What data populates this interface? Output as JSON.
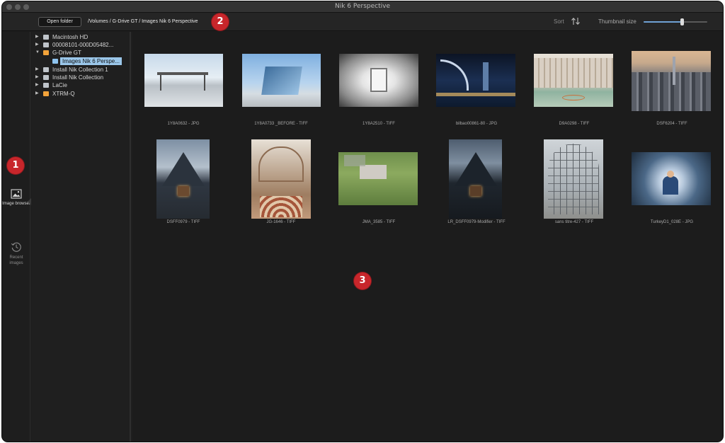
{
  "window": {
    "title": "Nik 6 Perspective"
  },
  "toolbar": {
    "open_folder_label": "Open folder",
    "path": "/Volumes / G-Drive GT / Images Nik 6 Perspective",
    "sort_label": "Sort",
    "sort_icon": "sort-arrows-icon",
    "thumbnail_size_label": "Thumbnail size",
    "thumbnail_size_value": 0.6
  },
  "sidebar": {
    "items": [
      {
        "label": "Image browser",
        "icon": "image-icon",
        "active": true
      },
      {
        "label": "Recent images",
        "icon": "clock-history-icon",
        "active": false
      }
    ]
  },
  "tree": {
    "items": [
      {
        "label": "Macintosh HD",
        "icon": "hard-drive-icon",
        "expanded": false,
        "color": "#bfc4ca"
      },
      {
        "label": "00008101-000D05482...",
        "icon": "device-icon",
        "expanded": false,
        "color": "#bfc4ca"
      },
      {
        "label": "G-Drive GT",
        "icon": "external-drive-icon",
        "expanded": true,
        "color": "#f2a33a"
      },
      {
        "label": "Images Nik 6 Perspe...",
        "icon": "folder-icon",
        "selected": true,
        "color": "#8ec3ee"
      },
      {
        "label": "Install Nik Collection 1",
        "icon": "disk-image-icon",
        "expanded": false,
        "color": "#bfc4ca"
      },
      {
        "label": "Install Nik Collection",
        "icon": "disk-image-icon",
        "expanded": false,
        "color": "#bfc4ca"
      },
      {
        "label": "LaCie",
        "icon": "hard-drive-icon",
        "expanded": false,
        "color": "#bfc4ca"
      },
      {
        "label": "XTRM-Q",
        "icon": "external-drive-icon",
        "expanded": false,
        "color": "#f2a33a"
      }
    ]
  },
  "thumbnails": [
    {
      "caption": "1Y8A0632 - JPG"
    },
    {
      "caption": "1Y8A0733 _BEFORE - TIFF"
    },
    {
      "caption": "1Y8A2510 - TIFF"
    },
    {
      "caption": "bilbao00861-80 - JPG"
    },
    {
      "caption": "D9A0298 - TIFF"
    },
    {
      "caption": "DSF6204 - TIFF"
    },
    {
      "caption": "DSFF0979 - TIFF"
    },
    {
      "caption": "JG-1646 - TIFF"
    },
    {
      "caption": "JMA_3585 - TIFF"
    },
    {
      "caption": "LR_DSFF0979-Modifier - TIFF"
    },
    {
      "caption": "sans titre-427 - TIFF"
    },
    {
      "caption": "TurkeyD1_028E - JPG"
    }
  ],
  "annotations": [
    {
      "label": "1"
    },
    {
      "label": "2"
    },
    {
      "label": "3"
    }
  ],
  "colors": {
    "accent": "#6fa1d4",
    "selection": "#9bc7ea",
    "badge": "#c8262b",
    "background": "#1c1c1c"
  }
}
